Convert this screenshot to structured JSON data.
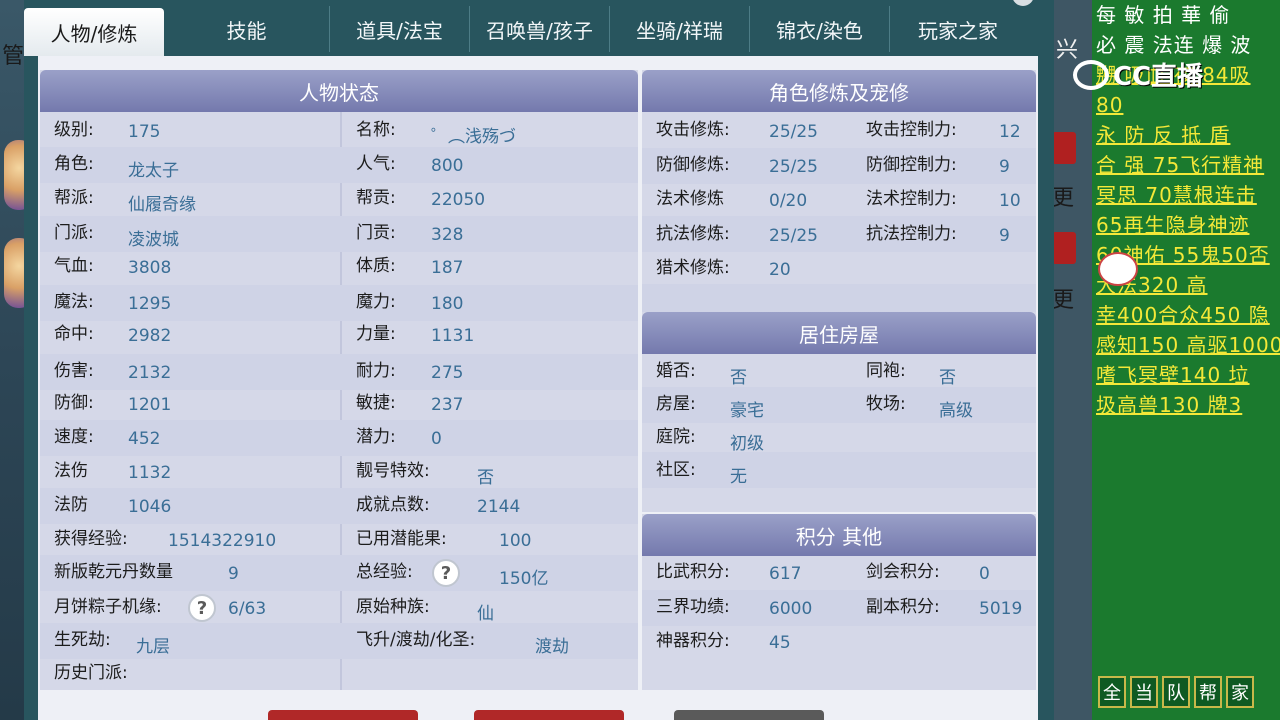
{
  "tabs": [
    "人物/修炼",
    "技能",
    "道具/法宝",
    "召唤兽/孩子",
    "坐骑/祥瑞",
    "锦衣/染色",
    "玩家之家"
  ],
  "background": {
    "left_text": [
      "管"
    ],
    "right_text": [
      "兴",
      "更",
      "更"
    ]
  },
  "status_panel": {
    "title": "人物状态",
    "left": [
      {
        "label": "级别:",
        "value": "175"
      },
      {
        "label": "角色:",
        "value": "龙太子"
      },
      {
        "label": "帮派:",
        "value": "仙履奇缘"
      },
      {
        "label": "门派:",
        "value": "凌波城"
      },
      {
        "label": "气血:",
        "value": "3808"
      },
      {
        "label": "魔法:",
        "value": "1295"
      },
      {
        "label": "命中:",
        "value": "2982"
      },
      {
        "label": "伤害:",
        "value": "2132"
      },
      {
        "label": "防御:",
        "value": "1201"
      },
      {
        "label": "速度:",
        "value": "452"
      },
      {
        "label": "法伤",
        "value": "1132"
      },
      {
        "label": "法防",
        "value": "1046"
      },
      {
        "label": "获得经验:",
        "value": "1514322910"
      },
      {
        "label": "新版乾元丹数量",
        "value": "9"
      },
      {
        "label": "月饼粽子机缘:",
        "value": "6/63"
      },
      {
        "label": "生死劫:",
        "value": "九层"
      },
      {
        "label": "历史门派:",
        "value": ""
      }
    ],
    "right": [
      {
        "label": "名称:",
        "value": "゜︵浅殇づ"
      },
      {
        "label": "人气:",
        "value": "800"
      },
      {
        "label": "帮贡:",
        "value": "22050"
      },
      {
        "label": "门贡:",
        "value": "328"
      },
      {
        "label": "体质:",
        "value": "187"
      },
      {
        "label": "魔力:",
        "value": "180"
      },
      {
        "label": "力量:",
        "value": "1131"
      },
      {
        "label": "耐力:",
        "value": "275"
      },
      {
        "label": "敏捷:",
        "value": "237"
      },
      {
        "label": "潜力:",
        "value": "0"
      },
      {
        "label": "靓号特效:",
        "value": "否"
      },
      {
        "label": "成就点数:",
        "value": "2144"
      },
      {
        "label": "已用潜能果:",
        "value": "100"
      },
      {
        "label": "总经验:",
        "value": "150亿"
      },
      {
        "label": "原始种族:",
        "value": "仙"
      },
      {
        "label": "飞升/渡劫/化圣:",
        "value": "渡劫"
      }
    ],
    "qmark": "?"
  },
  "cultivation_panel": {
    "title": "角色修炼及宠修",
    "rows": [
      {
        "l": "攻击修炼:",
        "lv": "25/25",
        "r": "攻击控制力:",
        "rv": "12"
      },
      {
        "l": "防御修炼:",
        "lv": "25/25",
        "r": "防御控制力:",
        "rv": "9"
      },
      {
        "l": "法术修炼",
        "lv": "0/20",
        "r": "法术控制力:",
        "rv": "10"
      },
      {
        "l": "抗法修炼:",
        "lv": "25/25",
        "r": "抗法控制力:",
        "rv": "9"
      },
      {
        "l": "猎术修炼:",
        "lv": "20",
        "r": "",
        "rv": ""
      }
    ]
  },
  "house_panel": {
    "title": "居住房屋",
    "rows": [
      {
        "l": "婚否:",
        "lv": "否",
        "r": "同袍:",
        "rv": "否"
      },
      {
        "l": "房屋:",
        "lv": "豪宅",
        "r": "牧场:",
        "rv": "高级"
      },
      {
        "l": "庭院:",
        "lv": "初级",
        "r": "",
        "rv": ""
      },
      {
        "l": "社区:",
        "lv": "无",
        "r": "",
        "rv": ""
      }
    ]
  },
  "score_panel": {
    "title": "积分 其他",
    "rows": [
      {
        "l": "比武积分:",
        "lv": "617",
        "r": "剑会积分:",
        "rv": "0"
      },
      {
        "l": "三界功绩:",
        "lv": "6000",
        "r": "副本积分:",
        "rv": "5019"
      },
      {
        "l": "神器积分:",
        "lv": "45",
        "r": "",
        "rv": ""
      }
    ]
  },
  "brand": {
    "logo_text": "CC直播"
  },
  "chat": [
    {
      "text": "每 敏 拍 華 偷",
      "plain": true
    },
    {
      "text": "必 震 法连 爆 波",
      "plain": true
    },
    {
      "text": "嬲 吸血 夜 84吸",
      "plain": false
    },
    {
      "text": "               80",
      "plain": false
    },
    {
      "text": "永 防 反 抵 盾",
      "plain": false
    },
    {
      "text": "合 强 75飞行精神",
      "plain": false
    },
    {
      "text": "冥思 70慧根连击",
      "plain": false
    },
    {
      "text": " 65再生隐身神迹",
      "plain": false
    },
    {
      "text": "60神佑 55鬼50否",
      "plain": false
    },
    {
      "text": "",
      "plain": true
    },
    {
      "text": "     大法320 高",
      "plain": false
    },
    {
      "text": "幸400合众450 隐",
      "plain": false
    },
    {
      "text": "感知150 高驱1000",
      "plain": false
    },
    {
      "text": " 嗜飞冥壁140 垃",
      "plain": false
    },
    {
      "text": "圾高兽130 牌3",
      "plain": false
    }
  ],
  "bottom_buttons": [
    "全",
    "当",
    "队",
    "帮",
    "家"
  ],
  "colors": {
    "value": "#3a6e96",
    "header": "#7479ad",
    "chat": "#f4e838",
    "panel_bg": "#28555e"
  }
}
